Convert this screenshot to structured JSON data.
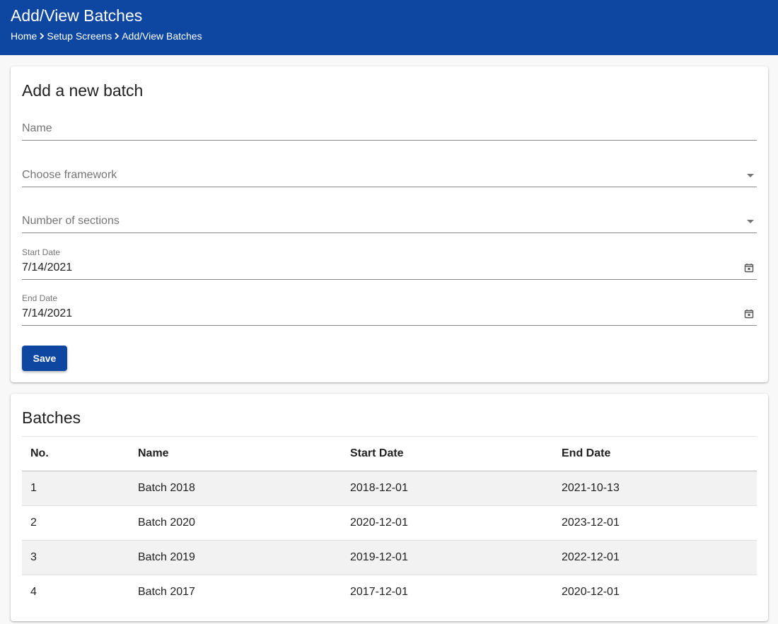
{
  "header": {
    "title": "Add/View Batches",
    "breadcrumb": [
      "Home",
      "Setup Screens",
      "Add/View Batches"
    ]
  },
  "form": {
    "title": "Add a new batch",
    "name_placeholder": "Name",
    "framework_placeholder": "Choose framework",
    "sections_placeholder": "Number of sections",
    "start_date_label": "Start Date",
    "start_date_value": "7/14/2021",
    "end_date_label": "End Date",
    "end_date_value": "7/14/2021",
    "save_label": "Save"
  },
  "batches": {
    "title": "Batches",
    "columns": [
      "No.",
      "Name",
      "Start Date",
      "End Date"
    ],
    "rows": [
      [
        "1",
        "Batch 2018",
        "2018-12-01",
        "2021-10-13"
      ],
      [
        "2",
        "Batch 2020",
        "2020-12-01",
        "2023-12-01"
      ],
      [
        "3",
        "Batch 2019",
        "2019-12-01",
        "2022-12-01"
      ],
      [
        "4",
        "Batch 2017",
        "2017-12-01",
        "2020-12-01"
      ]
    ]
  },
  "colors": {
    "primary": "#0d47a1",
    "row_stripe": "#f2f2f2"
  },
  "icons": {
    "breadcrumb_separator": "chevron-right-icon",
    "dropdown": "caret-down-icon",
    "date": "calendar-icon"
  }
}
